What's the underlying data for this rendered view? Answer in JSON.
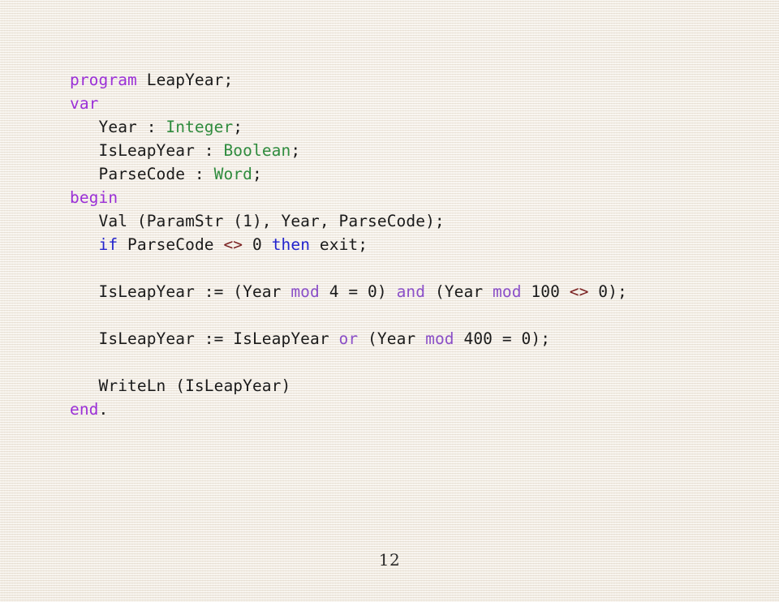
{
  "slide": {
    "title": "LeapYear",
    "language": "Pascal",
    "page_number": "12",
    "background_color": "#f4efe6"
  },
  "palette": {
    "keyword": "#9B30D8",
    "control": "#2222CC",
    "type": "#2E8B3D",
    "operator": "#8B4FC8",
    "relational": "#7B2222",
    "plain": "#1a1a1a",
    "paper": "#f4efe6"
  },
  "code": {
    "lines": [
      {
        "id": "line-1",
        "tokens": [
          {
            "text": "program",
            "kind": "keyword"
          },
          {
            "text": " LeapYear;",
            "kind": "plain"
          }
        ]
      },
      {
        "id": "line-2",
        "tokens": [
          {
            "text": "var",
            "kind": "keyword"
          }
        ]
      },
      {
        "id": "line-3",
        "tokens": [
          {
            "text": "   Year : ",
            "kind": "plain"
          },
          {
            "text": "Integer",
            "kind": "type"
          },
          {
            "text": ";",
            "kind": "plain"
          }
        ]
      },
      {
        "id": "line-4",
        "tokens": [
          {
            "text": "   IsLeapYear : ",
            "kind": "plain"
          },
          {
            "text": "Boolean",
            "kind": "type"
          },
          {
            "text": ";",
            "kind": "plain"
          }
        ]
      },
      {
        "id": "line-5",
        "tokens": [
          {
            "text": "   ParseCode : ",
            "kind": "plain"
          },
          {
            "text": "Word",
            "kind": "type"
          },
          {
            "text": ";",
            "kind": "plain"
          }
        ]
      },
      {
        "id": "line-6",
        "tokens": [
          {
            "text": "begin",
            "kind": "keyword"
          }
        ]
      },
      {
        "id": "line-7",
        "tokens": [
          {
            "text": "   Val (ParamStr (1), Year, ParseCode);",
            "kind": "plain"
          }
        ]
      },
      {
        "id": "line-8",
        "tokens": [
          {
            "text": "   ",
            "kind": "plain"
          },
          {
            "text": "if",
            "kind": "control"
          },
          {
            "text": " ParseCode ",
            "kind": "plain"
          },
          {
            "text": "<>",
            "kind": "relational"
          },
          {
            "text": " 0 ",
            "kind": "plain"
          },
          {
            "text": "then",
            "kind": "control"
          },
          {
            "text": " exit;",
            "kind": "plain"
          }
        ]
      },
      {
        "id": "line-9",
        "blank": true,
        "tokens": []
      },
      {
        "id": "line-10",
        "tokens": [
          {
            "text": "   IsLeapYear := (Year ",
            "kind": "plain"
          },
          {
            "text": "mod",
            "kind": "operator"
          },
          {
            "text": " 4 = 0) ",
            "kind": "plain"
          },
          {
            "text": "and",
            "kind": "operator"
          },
          {
            "text": " (Year ",
            "kind": "plain"
          },
          {
            "text": "mod",
            "kind": "operator"
          },
          {
            "text": " 100 ",
            "kind": "plain"
          },
          {
            "text": "<>",
            "kind": "relational"
          },
          {
            "text": " 0);",
            "kind": "plain"
          }
        ]
      },
      {
        "id": "line-11",
        "blank": true,
        "tokens": []
      },
      {
        "id": "line-12",
        "tokens": [
          {
            "text": "   IsLeapYear := IsLeapYear ",
            "kind": "plain"
          },
          {
            "text": "or",
            "kind": "operator"
          },
          {
            "text": " (Year ",
            "kind": "plain"
          },
          {
            "text": "mod",
            "kind": "operator"
          },
          {
            "text": " 400 = 0);",
            "kind": "plain"
          }
        ]
      },
      {
        "id": "line-13",
        "blank": true,
        "tokens": []
      },
      {
        "id": "line-14",
        "tokens": [
          {
            "text": "   WriteLn (IsLeapYear)",
            "kind": "plain"
          }
        ]
      },
      {
        "id": "line-15",
        "tokens": [
          {
            "text": "end",
            "kind": "keyword"
          },
          {
            "text": ".",
            "kind": "plain"
          }
        ]
      }
    ]
  }
}
